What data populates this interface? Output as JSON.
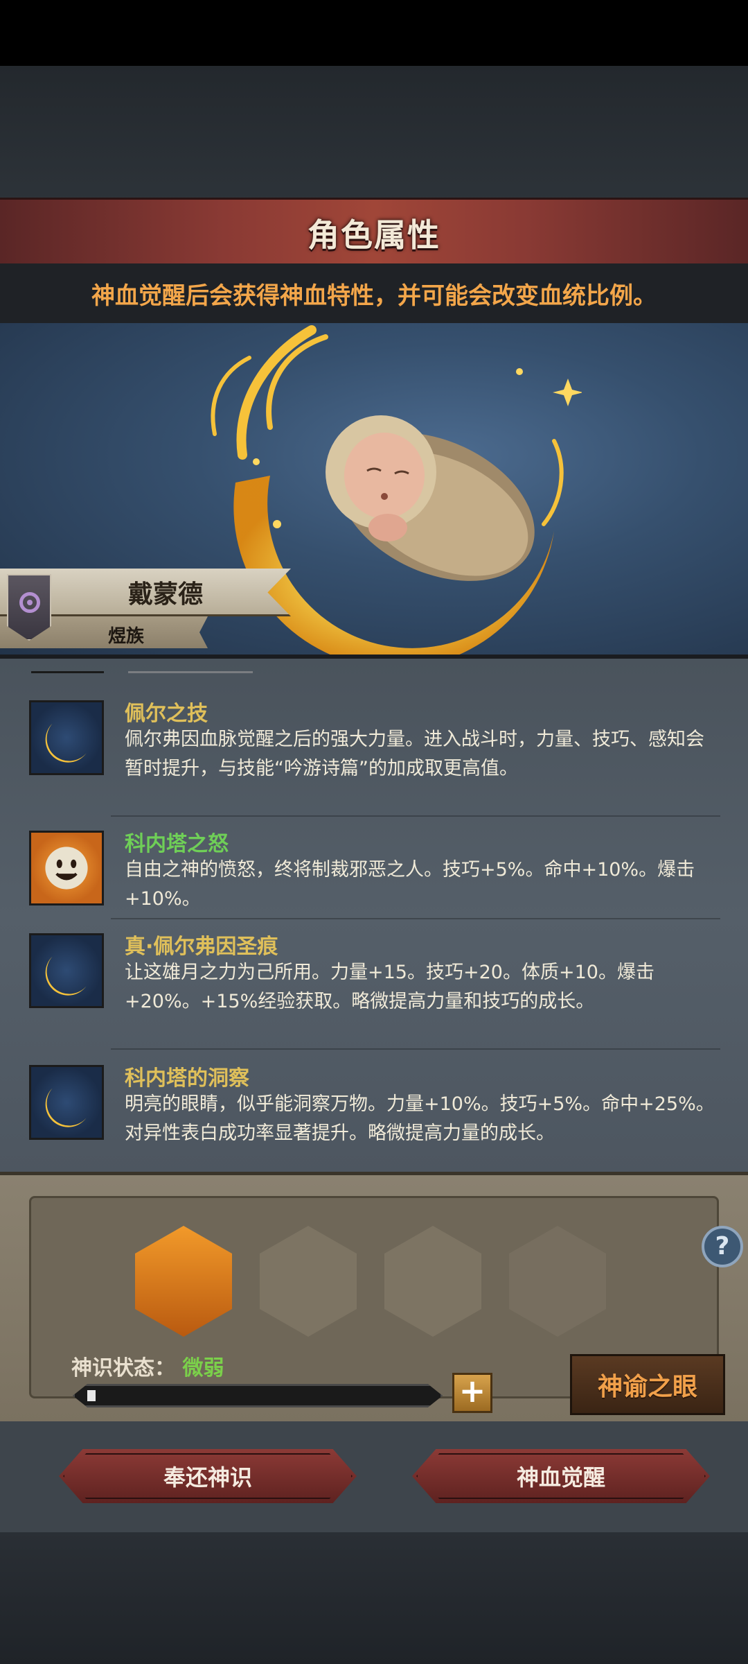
{
  "header": {
    "title": "角色属性",
    "notice": "神血觉醒后会获得神血特性，并可能会改变血统比例。"
  },
  "character": {
    "name": "戴蒙德",
    "race": "煜族"
  },
  "traits": [
    {
      "icon": "crescent-moon-icon",
      "title": "佩尔之技",
      "title_color": "#e0c05a",
      "desc": "佩尔弗因血脉觉醒之后的强大力量。进入战斗时，力量、技巧、感知会暂时提升，与技能“吟游诗篇”的加成取更高值。"
    },
    {
      "icon": "smiling-sun-icon",
      "title": "科内塔之怒",
      "title_color": "#6fcf57",
      "desc": "自由之神的愤怒，终将制裁邪恶之人。技巧+5%。命中+10%。爆击+10%。"
    },
    {
      "icon": "crescent-moon-icon",
      "title": "真·佩尔弗因圣痕",
      "title_color": "#e0c05a",
      "desc": "让这雄月之力为己所用。力量+15。技巧+20。体质+10。爆击+20%。+15%经验获取。略微提高力量和技巧的成长。"
    },
    {
      "icon": "crescent-moon-icon",
      "title": "科内塔的洞察",
      "title_color": "#e0c05a",
      "desc": "明亮的眼睛，似乎能洞察万物。力量+10%。技巧+5%。命中+25%。对异性表白成功率显著提升。略微提高力量的成长。"
    }
  ],
  "divine": {
    "status_label": "神识状态：",
    "status_value": "微弱",
    "progress": 0.02,
    "plus_label": "+",
    "help_label": "?",
    "oracle_button": "神谕之眼",
    "slots": [
      "filled",
      "filled",
      "filled",
      "empty"
    ]
  },
  "actions": {
    "return_button": "奉还神识",
    "awaken_button": "神血觉醒"
  },
  "colors": {
    "accent_orange": "#f3a64a",
    "status_green": "#7bd04a",
    "banner_red": "#8a3a34"
  }
}
